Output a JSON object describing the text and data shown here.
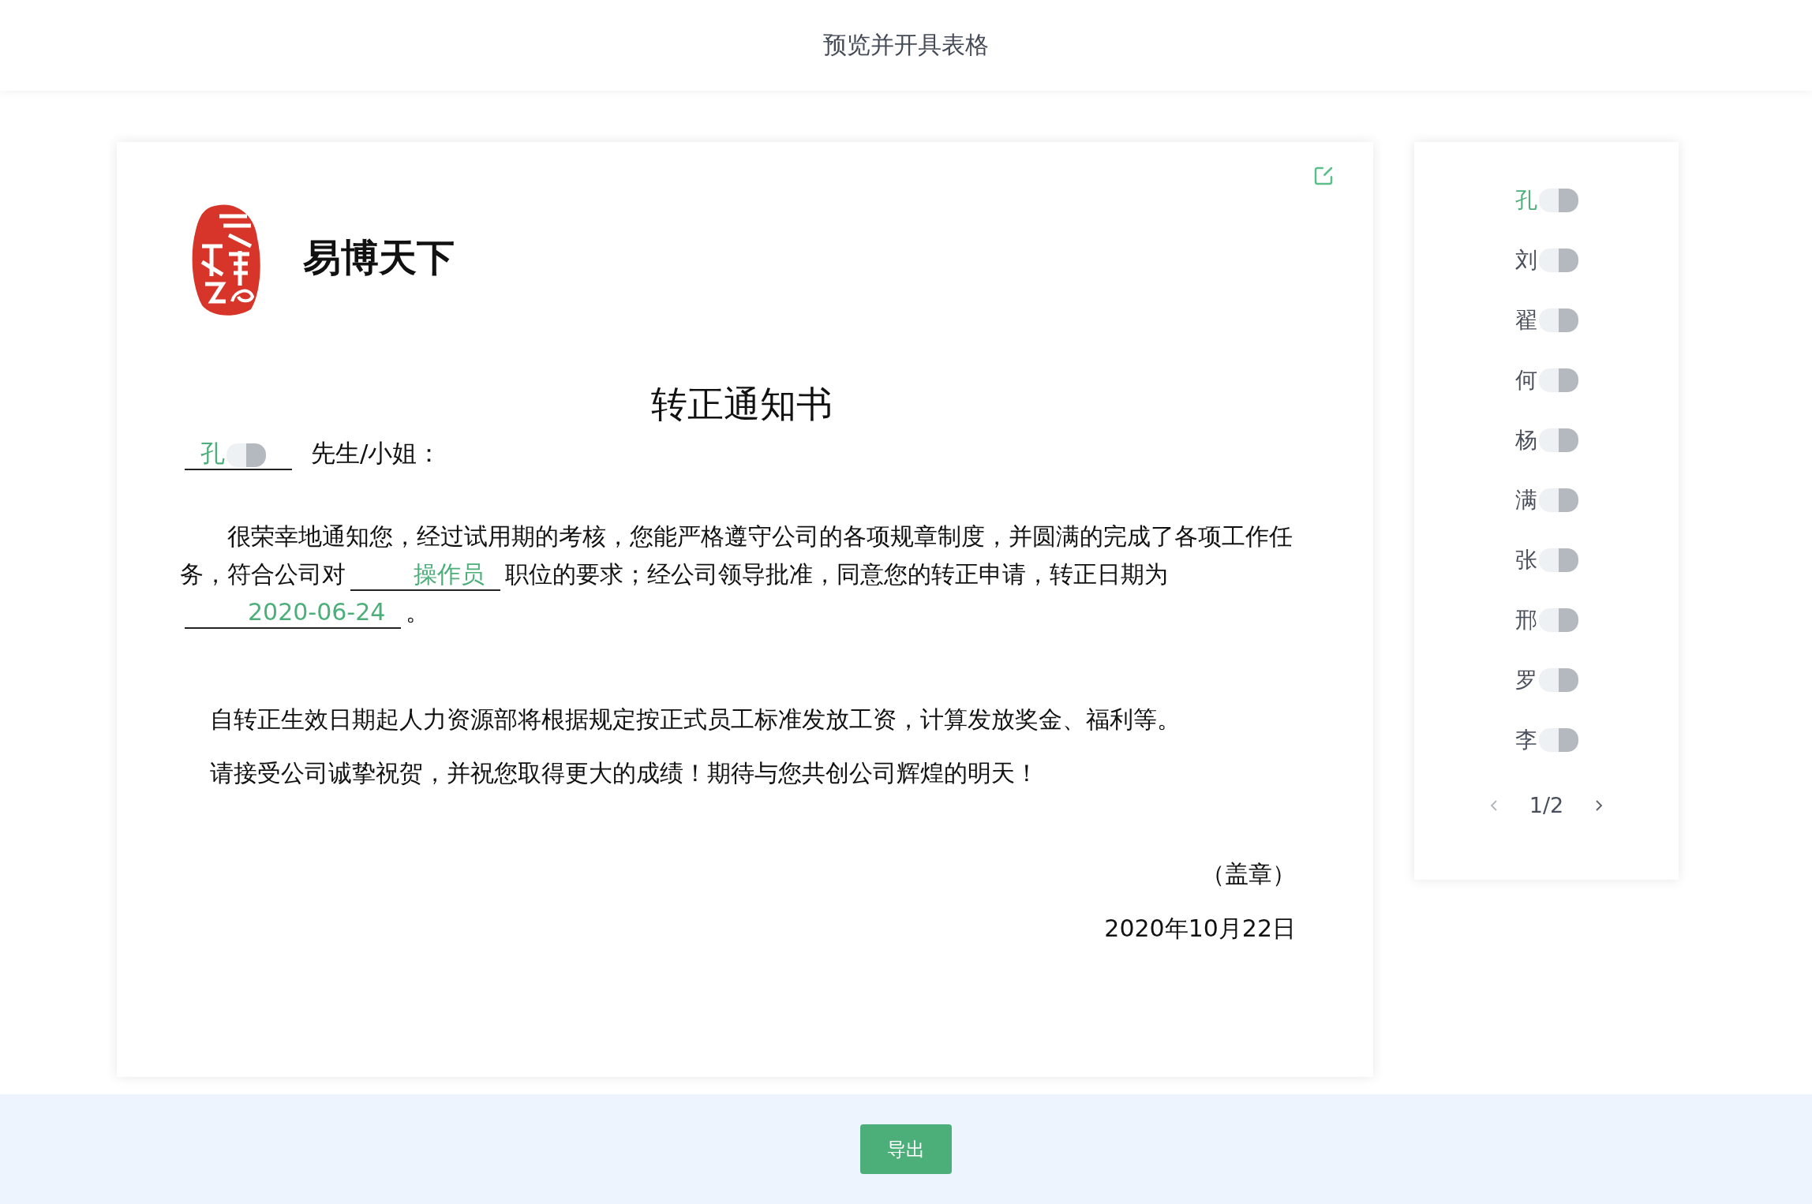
{
  "header": {
    "title": "预览并开具表格"
  },
  "document": {
    "company": "易博天下",
    "title": "转正通知书",
    "recipient": "孔",
    "salutation": "先生/小姐：",
    "paragraph_1": {
      "before": "很荣幸地通知您，经过试用期的考核，您能严格遵守公司的各项规章制度，并圆满的完成了各项工作任务，符合公司对",
      "position": "操作员",
      "middle": "职位的要求；经公司领导批准，同意您的转正申请，转正日期为",
      "date": "2020-06-24",
      "end": "。"
    },
    "paragraph_2": "自转正生效日期起人力资源部将根据规定按正式员工标准发放工资，计算发放奖金、福利等。",
    "paragraph_3": "请接受公司诚挚祝贺，并祝您取得更大的成绩！期待与您共创公司辉煌的明天！",
    "seal": "（盖章）",
    "issue_date": "2020年10月22日"
  },
  "employees": [
    {
      "name": "孔",
      "selected": true
    },
    {
      "name": "刘",
      "selected": false
    },
    {
      "name": "翟",
      "selected": false
    },
    {
      "name": "何",
      "selected": false
    },
    {
      "name": "杨",
      "selected": false
    },
    {
      "name": "满",
      "selected": false
    },
    {
      "name": "张",
      "selected": false
    },
    {
      "name": "邢",
      "selected": false
    },
    {
      "name": "罗",
      "selected": false
    },
    {
      "name": "李",
      "selected": false
    }
  ],
  "pagination": {
    "page": "1/2"
  },
  "export_button": "导出"
}
